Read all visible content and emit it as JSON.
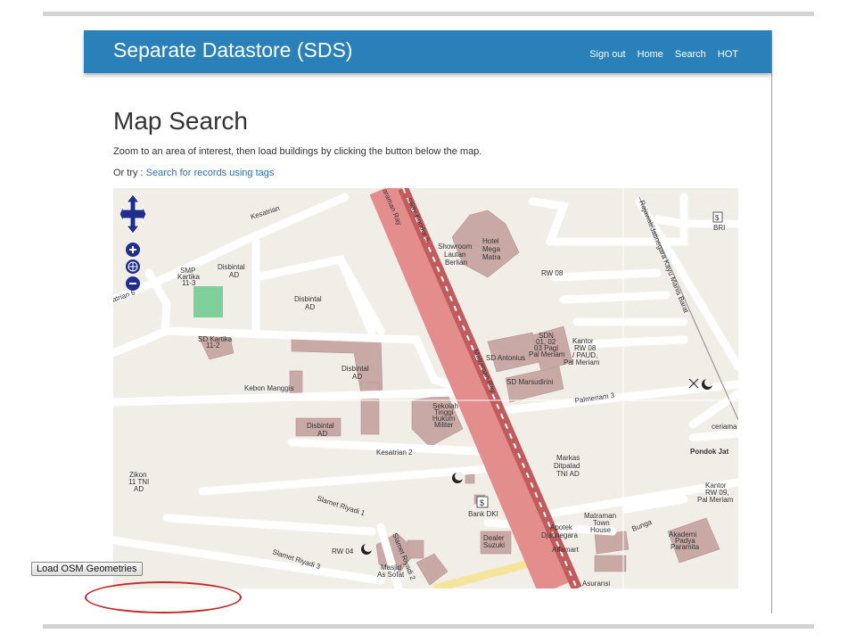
{
  "navbar": {
    "brand": "Separate Datastore (SDS)",
    "links": [
      "Sign out",
      "Home",
      "Search",
      "HOT"
    ]
  },
  "page": {
    "title": "Map Search",
    "intro": "Zoom to an area of interest, then load buildings by clicking the button below the map.",
    "or_try_prefix": "Or try : ",
    "or_try_link": "Search for records using tags"
  },
  "map": {
    "labels": {
      "kesatrian": "Kesatrian",
      "kesatrian6": "atrian 6",
      "smp": "SMP",
      "smp2": "Kartika",
      "smp3": "11-3",
      "disbintal_ad": "Disbintal",
      "ad": "AD",
      "sd_kartika": "SD Kartika",
      "sd_kartika2": "11-2",
      "kebon": "Kebon Manggis",
      "busway1": "sway Koridor 5",
      "matraman_top": "araman Ray",
      "matraman_mid": "Matraman Ray",
      "showroom1": "Showroom",
      "showroom2": "Lautan",
      "showroom3": "Berlian",
      "hotel1": "Hotel",
      "hotel2": "Mega",
      "hotel3": "Matra",
      "rw08": "RW 08",
      "rajawali": "Rajawali/Jatinegara Kayu Manis Barat",
      "bri": "BRI",
      "sdn1": "SDN",
      "sdn2": "01, 02",
      "sdn3": "03 Pagi",
      "sdn4": "Pal Meriam",
      "sd_antonius": "SD Antonius",
      "sd_marsudirini": "SD Marsudirini",
      "kantor1": "Kantor",
      "kantor2": "RW 08",
      "kantor3": "/ PAUD,",
      "kantor4": "Pal Meriam",
      "palmeriam3": "Palmeriam 3",
      "sekolah1": "Sekolah",
      "sekolah2": "Tinggi",
      "sekolah3": "Hukum",
      "sekolah4": "Militer",
      "kesatrian2": "Kesatrian 2",
      "markas1": "Markas",
      "markas2": "Ditpalad",
      "markas3": "TNI AD",
      "pondok": "Pondok Jat",
      "ceriama": "ceriama",
      "kantor_rw09_1": "Kantor",
      "kantor_rw09_2": "RW 09,",
      "kantor_rw09_3": "Pal Meriam",
      "zikon1": "Zikon",
      "zikon2": "11 TNI",
      "zikon3": "AD",
      "slamet1": "Slamet Riyadi 1",
      "slamet2": "Slamet Riyadi 2",
      "slamet3": "Slamet Riyadi 3",
      "bank_dki": "Bank DKI",
      "rw04": "RW 04",
      "masjid1": "Masjid",
      "masjid2": "As Sofat",
      "dealer1": "Dealer",
      "dealer2": "Suzuki",
      "apotek1": "Apotek",
      "apotek2": "Djatinegara",
      "alfamart": "Alfamart",
      "matraman_town1": "Matraman",
      "matraman_town2": "Town",
      "matraman_town3": "House",
      "bunga": "Bunga",
      "akademi1": "Akademi",
      "akademi2": "Padya",
      "akademi3": "Paramita",
      "asuransi": "Asuransi"
    }
  },
  "load_button": "Load OSM Geometries",
  "colors": {
    "navbar": "#2a80b9",
    "link": "#2a6fb0",
    "map_bg": "#f1eee8",
    "building": "#c9a9a6",
    "main_road": "#e48d8d",
    "park": "#7fcf9a",
    "highlight": "#c62828"
  }
}
